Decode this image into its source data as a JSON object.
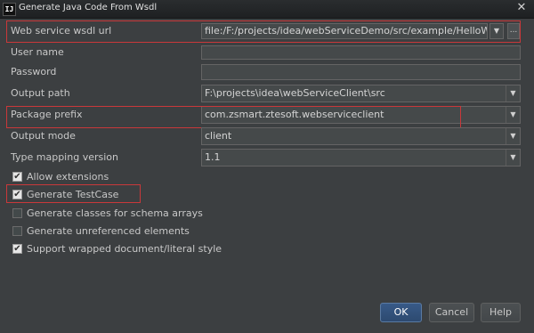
{
  "window": {
    "title": "Generate Java Code From Wsdl",
    "app_icon": "IJ",
    "close_glyph": "✕"
  },
  "form": {
    "wsdl_url": {
      "label": "Web service wsdl url",
      "value": "file:/F:/projects/idea/webServiceDemo/src/example/HelloWorld.wsdl",
      "ellipsis": "..."
    },
    "user_name": {
      "label": "User name",
      "value": ""
    },
    "password": {
      "label": "Password",
      "value": ""
    },
    "output_path": {
      "label": "Output path",
      "value": "F:\\projects\\idea\\webServiceClient\\src"
    },
    "package_prefix": {
      "label": "Package prefix",
      "value": "com.zsmart.ztesoft.webserviceclient"
    },
    "output_mode": {
      "label": "Output mode",
      "value": "client"
    },
    "type_mapping_version": {
      "label": "Type mapping version",
      "value": "1.1"
    }
  },
  "options": [
    {
      "label": "Allow extensions",
      "checked": true
    },
    {
      "label": "Generate TestCase",
      "checked": true
    },
    {
      "label": "Generate classes for schema arrays",
      "checked": false
    },
    {
      "label": "Generate unreferenced elements",
      "checked": false
    },
    {
      "label": "Support wrapped document/literal style",
      "checked": true
    }
  ],
  "buttons": {
    "ok": "OK",
    "cancel": "Cancel",
    "help": "Help"
  },
  "glyphs": {
    "dropdown": "▼",
    "check": "✔"
  },
  "colors": {
    "highlight": "#c9383a",
    "primary_button": "#385a88",
    "background": "#3c3f41"
  }
}
